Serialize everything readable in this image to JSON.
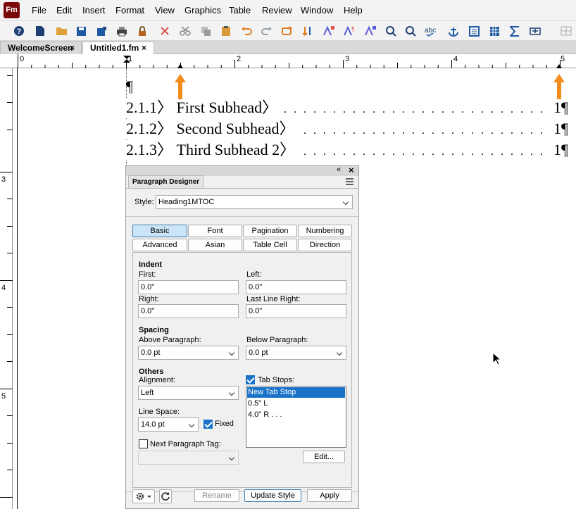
{
  "app": {
    "logo": "Fm"
  },
  "menu": [
    "File",
    "Edit",
    "Insert",
    "Format",
    "View",
    "Graphics",
    "Table",
    "Review",
    "Window",
    "Help"
  ],
  "toolbar_icons": [
    "help-icon",
    "new-document-icon",
    "open-folder-icon",
    "save-icon",
    "save-as-icon",
    "print-icon",
    "lock-icon",
    "delete-icon",
    "cut-icon",
    "copy-icon",
    "paste-icon",
    "undo-icon",
    "redo-icon",
    "repeat-icon",
    "sort-icon",
    "text-inset-icon",
    "paragraph-format-icon",
    "character-format-icon",
    "zoom-in-icon",
    "find-icon",
    "spelling-icon",
    "anchor-icon",
    "text-frame-icon",
    "table-icon",
    "equation-icon",
    "variable-icon"
  ],
  "tabs": [
    {
      "label": "WelcomeScreen",
      "close": "×"
    },
    {
      "label": "Untitled1.fm",
      "close": "×"
    }
  ],
  "ruler": {
    "marks": [
      "0",
      "1",
      "2",
      "3",
      "4",
      "5"
    ],
    "vmarks": [
      "3",
      "4",
      "5"
    ]
  },
  "document": {
    "pilcrow": "¶",
    "toc": [
      {
        "text": "2.1.1〉 First Subhead〉",
        "page": "1¶"
      },
      {
        "text": "2.1.2〉 Second Subhead〉",
        "page": "1¶"
      },
      {
        "text": "2.1.3〉 Third Subhead 2〉",
        "page": "1¶"
      }
    ]
  },
  "panel": {
    "title": "Paragraph Designer",
    "collapse": "«",
    "close": "×",
    "style_label": "Style:",
    "style_value": "Heading1MTOC",
    "tabs_row1": [
      "Basic",
      "Font",
      "Pagination",
      "Numbering"
    ],
    "tabs_row2": [
      "Advanced",
      "Asian",
      "Table Cell",
      "Direction"
    ],
    "indent": {
      "heading": "Indent",
      "first_label": "First:",
      "first_value": "0.0\"",
      "left_label": "Left:",
      "left_value": "0.0\"",
      "right_label": "Right:",
      "right_value": "0.0\"",
      "last_label": "Last Line Right:",
      "last_value": "0.0\""
    },
    "spacing": {
      "heading": "Spacing",
      "above_label": "Above Paragraph:",
      "above_value": "0.0 pt",
      "below_label": "Below Paragraph:",
      "below_value": "0.0 pt"
    },
    "others": {
      "heading": "Others",
      "alignment_label": "Alignment:",
      "alignment_value": "Left",
      "linespace_label": "Line Space:",
      "linespace_value": "14.0 pt",
      "fixed_label": "Fixed",
      "nexttag_label": "Next Paragraph Tag:",
      "tabstops_label": "Tab Stops:",
      "tabstops": [
        "New Tab Stop",
        "0.5\"  L",
        "4.0\"  R  . . ."
      ],
      "edit_button": "Edit..."
    },
    "footer": {
      "rename": "Rename",
      "update": "Update Style",
      "apply": "Apply"
    }
  },
  "colors": {
    "accent_orange": "#f28c1c",
    "selection_blue": "#1a73c9",
    "logo_red": "#7a0a0a"
  }
}
